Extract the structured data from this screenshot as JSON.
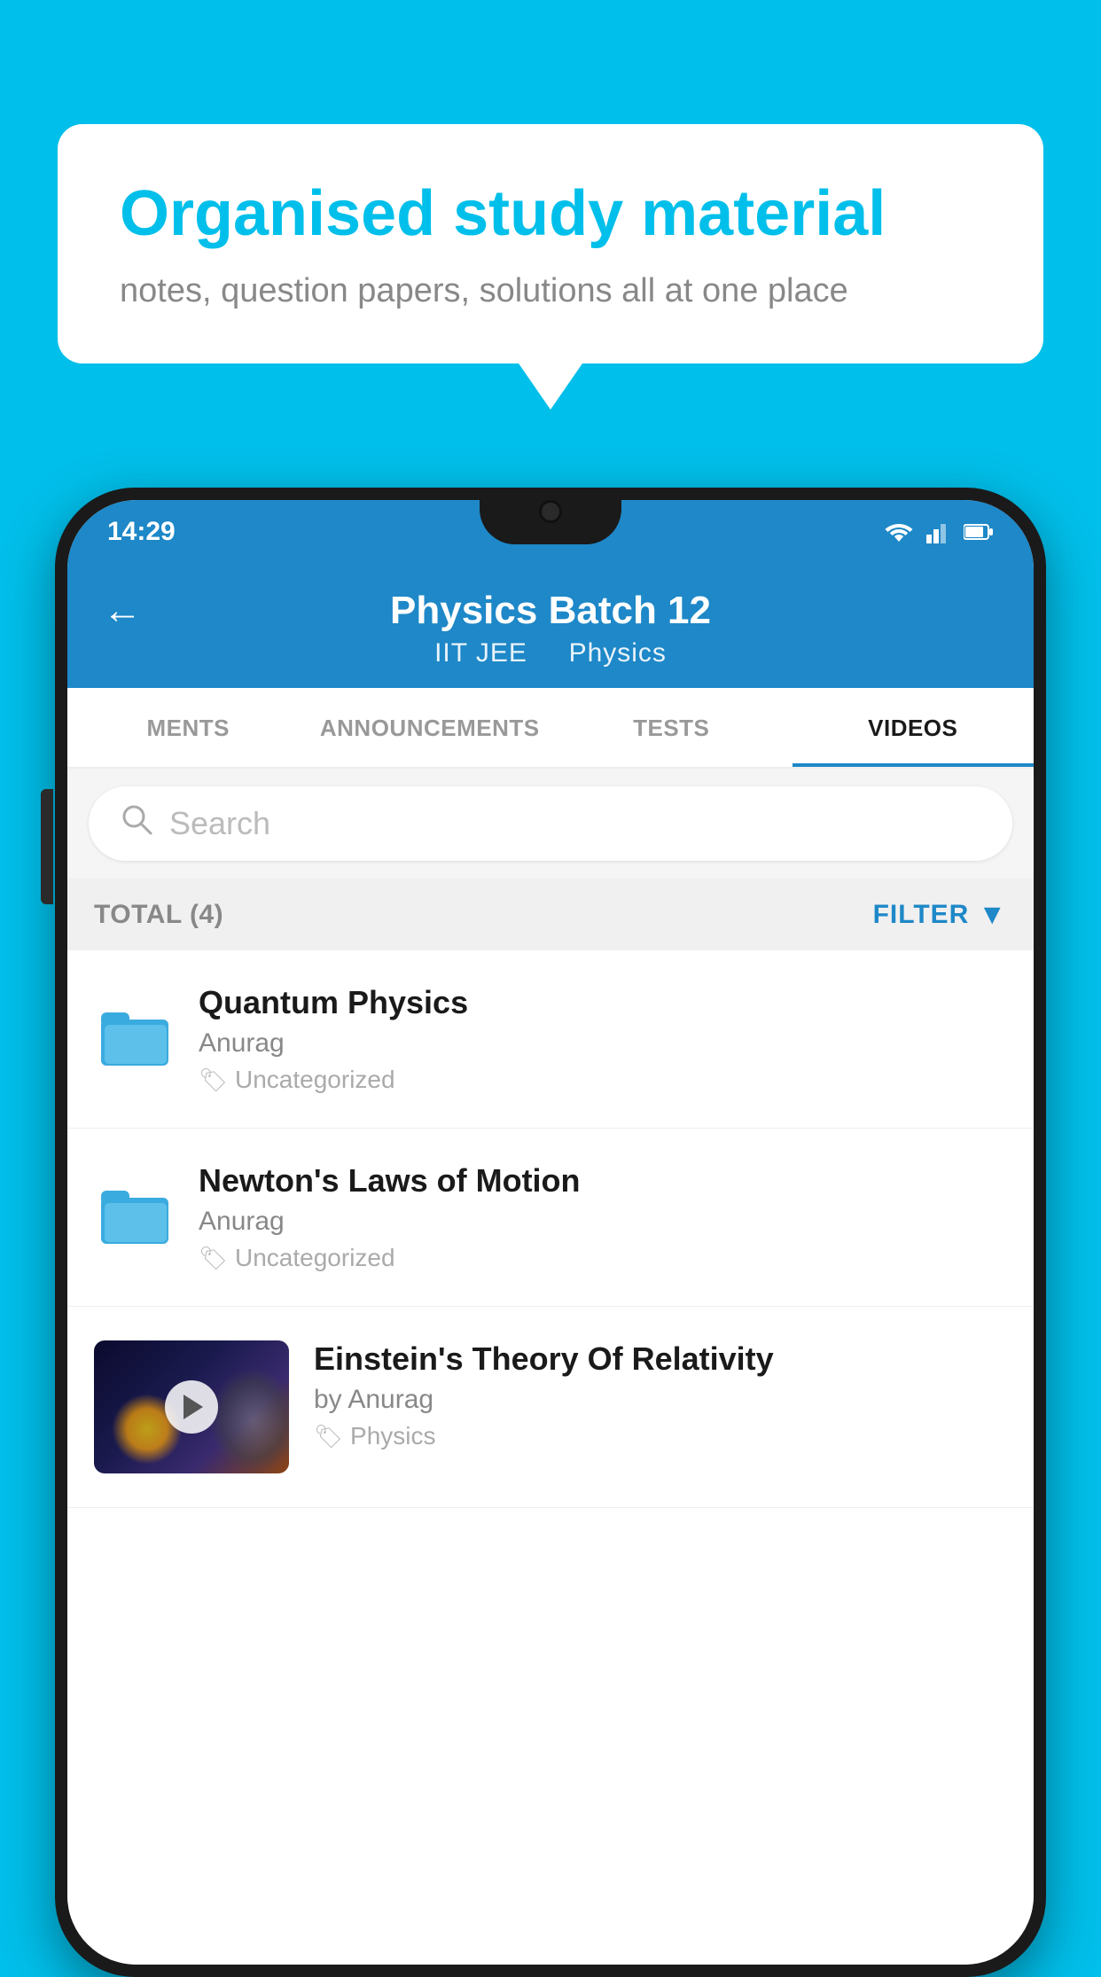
{
  "background_color": "#00BFEA",
  "speech_bubble": {
    "title": "Organised study material",
    "subtitle": "notes, question papers, solutions all at one place"
  },
  "phone": {
    "status_bar": {
      "time": "14:29"
    },
    "header": {
      "title": "Physics Batch 12",
      "subtitle_part1": "IIT JEE",
      "subtitle_part2": "Physics",
      "back_label": "←"
    },
    "tabs": [
      {
        "label": "MENTS",
        "active": false
      },
      {
        "label": "ANNOUNCEMENTS",
        "active": false
      },
      {
        "label": "TESTS",
        "active": false
      },
      {
        "label": "VIDEOS",
        "active": true
      }
    ],
    "search": {
      "placeholder": "Search"
    },
    "filter_bar": {
      "total_label": "TOTAL (4)",
      "filter_label": "FILTER"
    },
    "list_items": [
      {
        "title": "Quantum Physics",
        "author": "Anurag",
        "tag": "Uncategorized",
        "type": "folder"
      },
      {
        "title": "Newton's Laws of Motion",
        "author": "Anurag",
        "tag": "Uncategorized",
        "type": "folder"
      },
      {
        "title": "Einstein's Theory Of Relativity",
        "author": "by Anurag",
        "tag": "Physics",
        "type": "video"
      }
    ]
  }
}
